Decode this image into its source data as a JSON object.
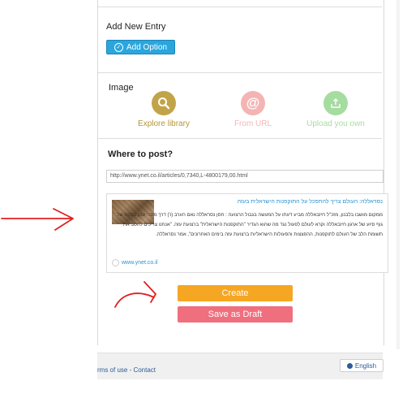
{
  "add_entry": {
    "title": "Add New Entry",
    "button_label": "Add Option"
  },
  "image": {
    "title": "Image",
    "tools": [
      {
        "label": "Explore library",
        "icon": "search-icon",
        "color": "#b5963a",
        "circle": "#c2a448"
      },
      {
        "label": "From URL",
        "icon": "at-icon",
        "color": "#f1b8b8",
        "circle": "#f4b4b4"
      },
      {
        "label": "Upload you own",
        "icon": "upload-icon",
        "color": "#a9dca2",
        "circle": "#a5dca0"
      }
    ]
  },
  "post": {
    "title": "Where to post?",
    "url_value": "http://www.ynet.co.il/articles/0,7340,L-4800179,00.html"
  },
  "preview": {
    "headline": "נסראללה: העולם צריך להתפכל על התוקפנות הישראלית בעזה",
    "text": "ממקום מושבו בלבנון, מזכ\"ל חיזבאללה מביע דעתו על המעשה בגבול הרצועה : חסן נסראללה נאם הערב (ו') דרך מסכי ענק בטקס של גוף סיוע של ארגון חיזבאללה וקרא לעולם לפעול נגד מה שהוא הגדיר \"התוקפנות הישראלית\" ברצועת עזה. \"אנחנו צריכים להסב את תשומת הלב של העולם לתוקפנות, ההפצצות והפעולות הישראליות ברצועת עזה בימים האחרונים\", אמר נסראללה.",
    "link": "www.ynet.co.il"
  },
  "actions": {
    "create_label": "Create",
    "draft_label": "Save as Draft",
    "create_color": "#f5a623",
    "draft_color": "#ef6f7e"
  },
  "footer": {
    "links": "rms of use - Contact",
    "language": "English"
  }
}
